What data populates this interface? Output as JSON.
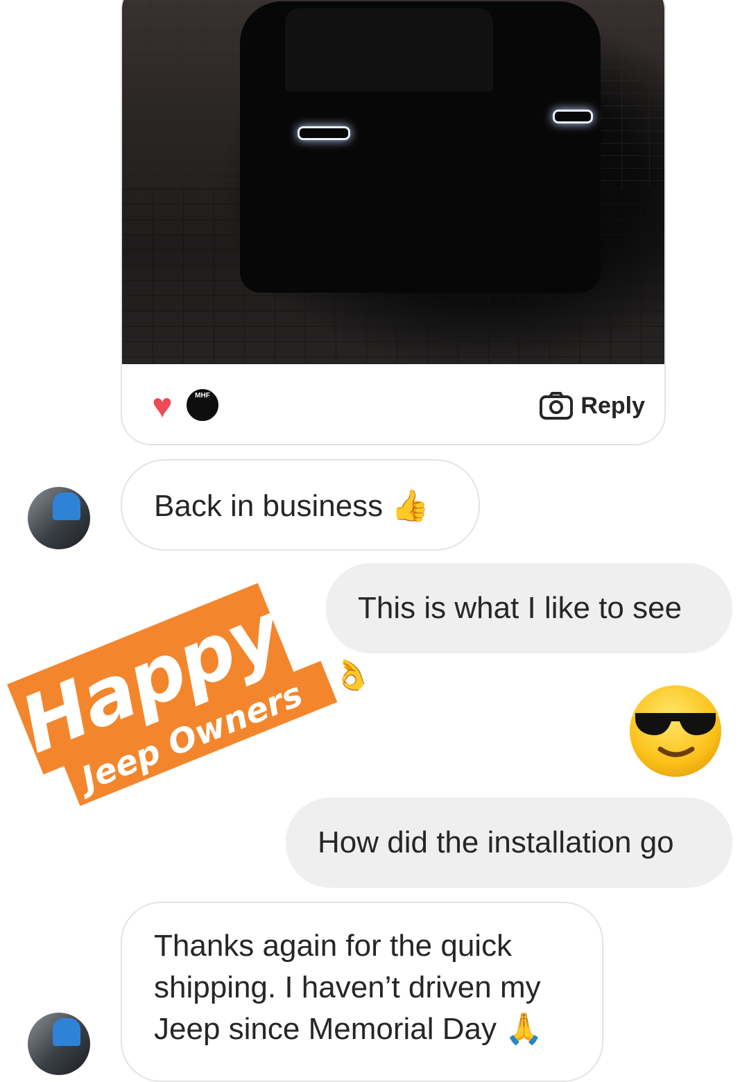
{
  "shared_post": {
    "reaction_icon": "heart-icon",
    "mini_avatar_text": "MHF",
    "reply_label": "Reply",
    "colors": {
      "heart": "#ed4956"
    }
  },
  "messages": [
    {
      "from": "them",
      "text": "Back in business",
      "emoji": "👍"
    },
    {
      "from": "me",
      "text": "This is what I like to see"
    },
    {
      "from": "me",
      "emoji_only": "😎"
    },
    {
      "from": "me",
      "text": "How did the installation go"
    },
    {
      "from": "them",
      "lines": [
        "Thanks again for the quick",
        "shipping. I haven’t driven my",
        "Jeep since Memorial Day"
      ],
      "emoji": "🙏"
    }
  ],
  "sticker": {
    "line1": "Happy",
    "line2": "Jeep Owners",
    "emoji": "👌",
    "color": "#f3862d"
  }
}
